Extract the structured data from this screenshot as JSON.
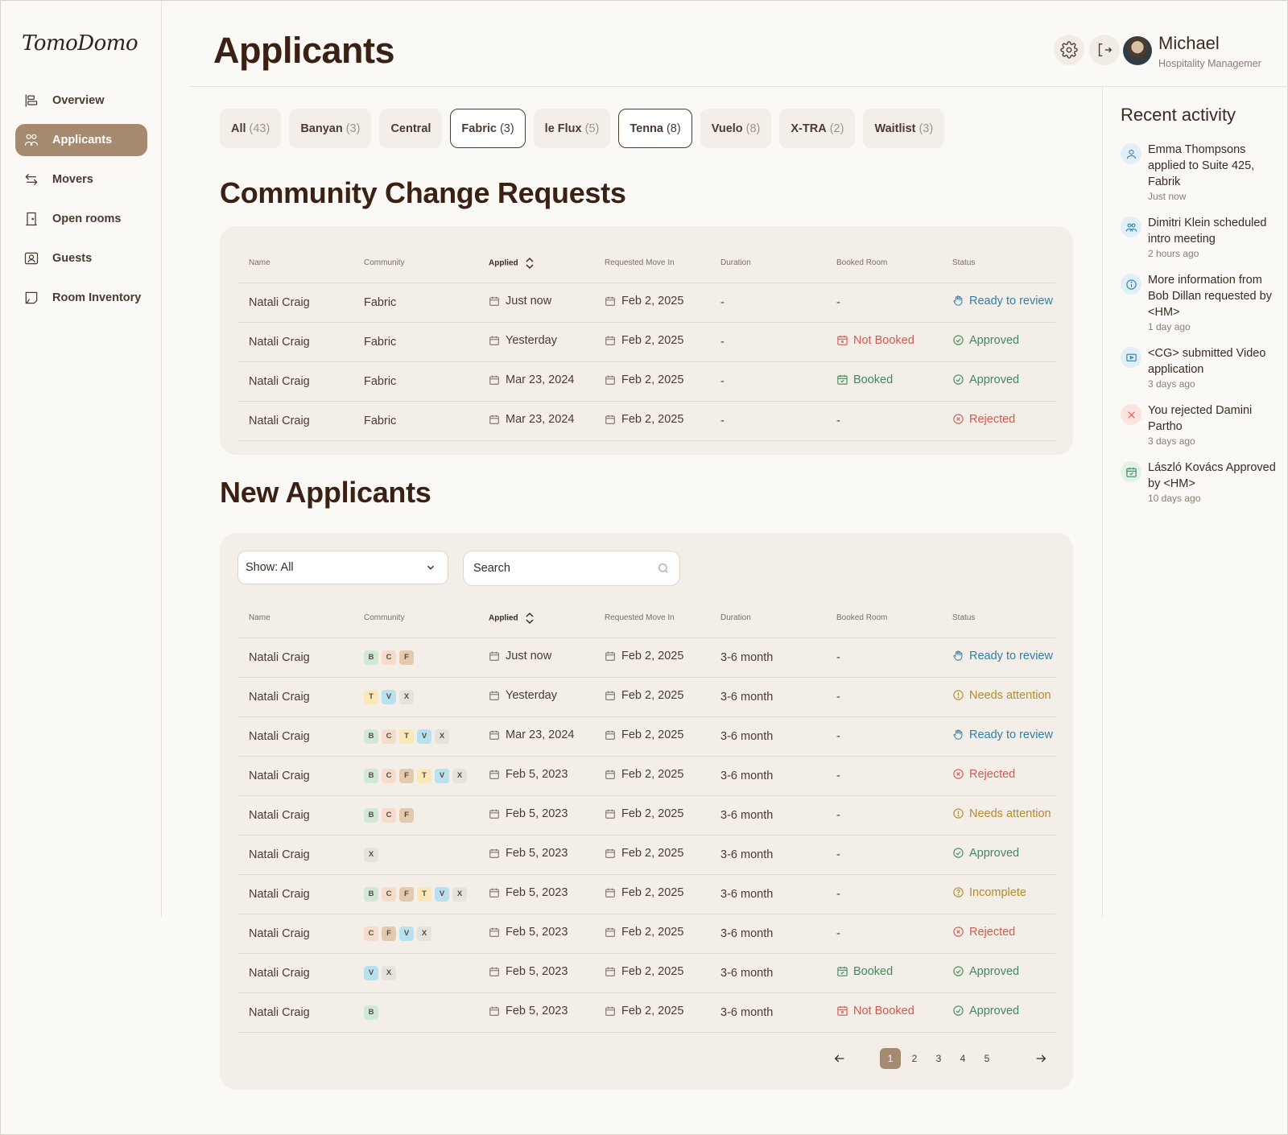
{
  "app": {
    "logo": "TomoDomo"
  },
  "sidebar": {
    "items": [
      {
        "label": "Overview",
        "icon": "overview-icon",
        "active": false
      },
      {
        "label": "Applicants",
        "icon": "applicants-icon",
        "active": true
      },
      {
        "label": "Movers",
        "icon": "movers-icon",
        "active": false
      },
      {
        "label": "Open rooms",
        "icon": "door-icon",
        "active": false
      },
      {
        "label": "Guests",
        "icon": "guest-icon",
        "active": false
      },
      {
        "label": "Room Inventory",
        "icon": "inventory-icon",
        "active": false
      }
    ]
  },
  "header": {
    "title": "Applicants",
    "user_name": "Michael",
    "user_role": "Hospitality Managemer"
  },
  "tabs": [
    {
      "label": "All",
      "count": "(43)",
      "selected": false
    },
    {
      "label": "Banyan",
      "count": "(3)",
      "selected": false
    },
    {
      "label": "Central",
      "count": "",
      "selected": false
    },
    {
      "label": "Fabric",
      "count": "(3)",
      "selected": true
    },
    {
      "label": "le Flux",
      "count": "(5)",
      "selected": false
    },
    {
      "label": "Tenna",
      "count": "(8)",
      "selected": true
    },
    {
      "label": "Vuelo",
      "count": "(8)",
      "selected": false
    },
    {
      "label": "X-TRA",
      "count": "(2)",
      "selected": false
    },
    {
      "label": "Waitlist",
      "count": "(3)",
      "selected": false
    }
  ],
  "change_requests": {
    "title": "Community Change Requests",
    "columns": [
      "Name",
      "Community",
      "Applied",
      "Requested Move In",
      "Duration",
      "Booked Room",
      "Status"
    ],
    "rows": [
      {
        "name": "Natali Craig",
        "community": "Fabric",
        "applied": "Just now",
        "move_in": "Feb 2, 2025",
        "duration": "-",
        "booked": "-",
        "booked_state": "",
        "status": "Ready to review",
        "status_type": "review"
      },
      {
        "name": "Natali Craig",
        "community": "Fabric",
        "applied": "Yesterday",
        "move_in": "Feb 2, 2025",
        "duration": "-",
        "booked": "Not Booked",
        "booked_state": "notbooked",
        "status": "Approved",
        "status_type": "approved"
      },
      {
        "name": "Natali Craig",
        "community": "Fabric",
        "applied": "Mar 23, 2024",
        "move_in": "Feb 2, 2025",
        "duration": "-",
        "booked": "Booked",
        "booked_state": "booked",
        "status": "Approved",
        "status_type": "approved"
      },
      {
        "name": "Natali Craig",
        "community": "Fabric",
        "applied": "Mar 23, 2024",
        "move_in": "Feb 2, 2025",
        "duration": "-",
        "booked": "-",
        "booked_state": "",
        "status": "Rejected",
        "status_type": "rejected"
      }
    ]
  },
  "new_applicants": {
    "title": "New Applicants",
    "show_select": "Show: All",
    "search_placeholder": "Search",
    "columns": [
      "Name",
      "Community",
      "Applied",
      "Requested Move In",
      "Duration",
      "Booked Room",
      "Status"
    ],
    "rows": [
      {
        "name": "Natali Craig",
        "communities": [
          "B",
          "C",
          "F"
        ],
        "applied": "Just now",
        "move_in": "Feb 2, 2025",
        "duration": "3-6 month",
        "booked": "-",
        "booked_state": "",
        "status": "Ready to review",
        "status_type": "review"
      },
      {
        "name": "Natali Craig",
        "communities": [
          "T",
          "V",
          "X"
        ],
        "applied": "Yesterday",
        "move_in": "Feb 2, 2025",
        "duration": "3-6 month",
        "booked": "-",
        "booked_state": "",
        "status": "Needs attention",
        "status_type": "attention"
      },
      {
        "name": "Natali Craig",
        "communities": [
          "B",
          "C",
          "T",
          "V",
          "X"
        ],
        "applied": "Mar 23, 2024",
        "move_in": "Feb 2, 2025",
        "duration": "3-6 month",
        "booked": "-",
        "booked_state": "",
        "status": "Ready to review",
        "status_type": "review"
      },
      {
        "name": "Natali Craig",
        "communities": [
          "B",
          "C",
          "F",
          "T",
          "V",
          "X"
        ],
        "applied": "Feb 5, 2023",
        "move_in": "Feb 2, 2025",
        "duration": "3-6 month",
        "booked": "-",
        "booked_state": "",
        "status": "Rejected",
        "status_type": "rejected"
      },
      {
        "name": "Natali Craig",
        "communities": [
          "B",
          "C",
          "F"
        ],
        "applied": "Feb 5, 2023",
        "move_in": "Feb 2, 2025",
        "duration": "3-6 month",
        "booked": "-",
        "booked_state": "",
        "status": "Needs attention",
        "status_type": "attention"
      },
      {
        "name": "Natali Craig",
        "communities": [
          "X"
        ],
        "applied": "Feb 5, 2023",
        "move_in": "Feb 2, 2025",
        "duration": "3-6 month",
        "booked": "-",
        "booked_state": "",
        "status": "Approved",
        "status_type": "approved"
      },
      {
        "name": "Natali Craig",
        "communities": [
          "B",
          "C",
          "F",
          "T",
          "V",
          "X"
        ],
        "applied": "Feb 5, 2023",
        "move_in": "Feb 2, 2025",
        "duration": "3-6 month",
        "booked": "-",
        "booked_state": "",
        "status": "Incomplete",
        "status_type": "incomplete"
      },
      {
        "name": "Natali Craig",
        "communities": [
          "C",
          "F",
          "V",
          "X"
        ],
        "applied": "Feb 5, 2023",
        "move_in": "Feb 2, 2025",
        "duration": "3-6 month",
        "booked": "-",
        "booked_state": "",
        "status": "Rejected",
        "status_type": "rejected"
      },
      {
        "name": "Natali Craig",
        "communities": [
          "V",
          "X"
        ],
        "applied": "Feb 5, 2023",
        "move_in": "Feb 2, 2025",
        "duration": "3-6 month",
        "booked": "Booked",
        "booked_state": "booked",
        "status": "Approved",
        "status_type": "approved"
      },
      {
        "name": "Natali Craig",
        "communities": [
          "B"
        ],
        "applied": "Feb 5, 2023",
        "move_in": "Feb 2, 2025",
        "duration": "3-6 month",
        "booked": "Not Booked",
        "booked_state": "notbooked",
        "status": "Approved",
        "status_type": "approved"
      }
    ],
    "pagination": {
      "pages": [
        "1",
        "2",
        "3",
        "4",
        "5"
      ],
      "current": "1"
    }
  },
  "community_chip_colors": {
    "B": "#cfe9d6",
    "C": "#f6dccb",
    "F": "#e3c9ae",
    "T": "#fbe8b8",
    "V": "#b9e0ee",
    "X": "#e6e3df"
  },
  "recent_activity": {
    "title": "Recent activity",
    "items": [
      {
        "text": "Emma Thompsons applied to Suite 425, Fabrik",
        "time": "Just now",
        "icon": "user-icon",
        "bg": "#e1f0f7",
        "color": "#2f7ea8"
      },
      {
        "text": "Dimitri Klein scheduled intro meeting",
        "time": "2 hours ago",
        "icon": "users-icon",
        "bg": "#e1f0f7",
        "color": "#2f7ea8"
      },
      {
        "text": "More information from Bob Dillan requested by <HM>",
        "time": "1 day ago",
        "icon": "info-icon",
        "bg": "#e1f0f7",
        "color": "#2f7ea8"
      },
      {
        "text": "<CG> submitted Video application",
        "time": "3 days ago",
        "icon": "video-icon",
        "bg": "#e1f0f7",
        "color": "#2f7ea8"
      },
      {
        "text": "You rejected Damini Partho",
        "time": "3 days ago",
        "icon": "x-icon",
        "bg": "#fbe3e0",
        "color": "#d05a4e"
      },
      {
        "text": "László Kovács Approved by <HM>",
        "time": "10 days ago",
        "icon": "calendar-check-icon",
        "bg": "#e2f2e6",
        "color": "#3f8a5a"
      }
    ]
  }
}
